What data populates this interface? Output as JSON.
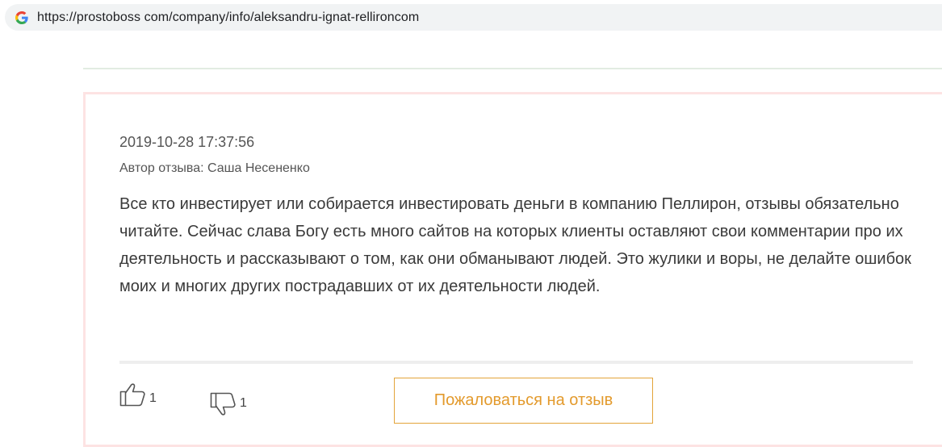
{
  "browser": {
    "url": "https://prostoboss com/company/info/aleksandru-ignat-rellironcom",
    "favicon": "google-g-icon"
  },
  "review": {
    "date": "2019-10-28 17:37:56",
    "author": "Автор отзыва: Саша Несененко",
    "text": "Все кто инвестирует или собирается инвестировать деньги в компанию Пеллирон, отзывы обязательно читайте. Сейчас слава Богу есть много сайтов на которых клиенты оставляют свои комментарии про их деятельность и рассказывают о том, как они обманывают людей. Это жулики и воры, не делайте ошибок моих и многих других пострадавших от их деятельности людей.",
    "likes": "1",
    "dislikes": "1",
    "like_icon": "thumbs-up-icon",
    "dislike_icon": "thumbs-down-icon",
    "report_label": "Пожаловаться на отзыв"
  },
  "colors": {
    "card_border": "#fde3e3",
    "accent": "#e3a43a"
  }
}
